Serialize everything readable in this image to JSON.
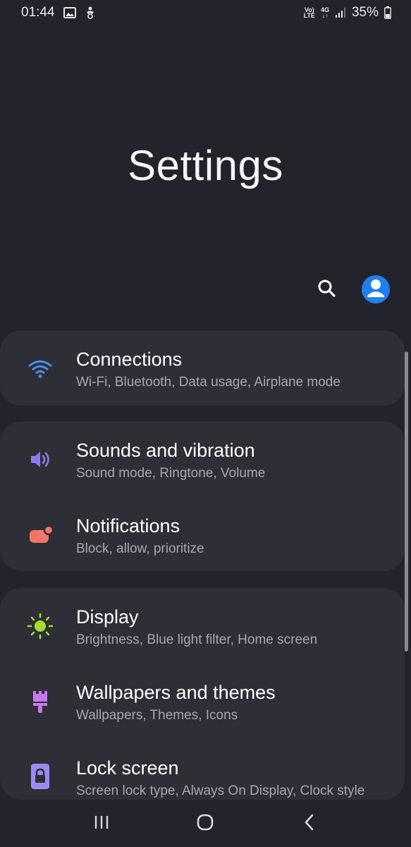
{
  "status_bar": {
    "time": "01:44",
    "battery_percent": "35%",
    "volte_top": "Vo)",
    "volte_bottom": "LTE",
    "network_type": "4G",
    "icons": [
      "image-icon",
      "accessibility-icon",
      "volte-icon",
      "4g-icon",
      "signal-icon",
      "battery-icon"
    ]
  },
  "header": {
    "title": "Settings"
  },
  "actions": {
    "icons": [
      "search-icon",
      "account-icon"
    ]
  },
  "groups": [
    {
      "items": [
        {
          "title": "Connections",
          "subtitle": "Wi-Fi, Bluetooth, Data usage, Airplane mode",
          "icon": "wifi-icon",
          "color": "#4a90f0"
        }
      ]
    },
    {
      "items": [
        {
          "title": "Sounds and vibration",
          "subtitle": "Sound mode, Ringtone, Volume",
          "icon": "speaker-icon",
          "color": "#8a7cf0"
        },
        {
          "title": "Notifications",
          "subtitle": "Block, allow, prioritize",
          "icon": "notification-icon",
          "color": "#f07866"
        }
      ]
    },
    {
      "items": [
        {
          "title": "Display",
          "subtitle": "Brightness, Blue light filter, Home screen",
          "icon": "sun-icon",
          "color": "#a6dd2e"
        },
        {
          "title": "Wallpapers and themes",
          "subtitle": "Wallpapers, Themes, Icons",
          "icon": "brush-icon",
          "color": "#c878ec"
        },
        {
          "title": "Lock screen",
          "subtitle": "Screen lock type, Always On Display, Clock style",
          "icon": "lock-icon",
          "color": "#9a8af4"
        }
      ]
    }
  ],
  "nav_bar": {
    "icons": [
      "recents-icon",
      "home-icon",
      "back-icon"
    ]
  }
}
